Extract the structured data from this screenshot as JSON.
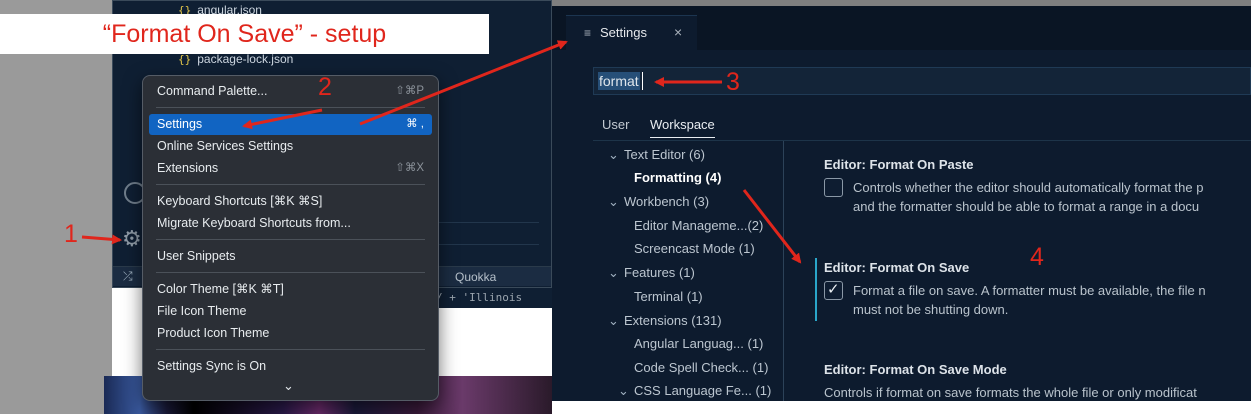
{
  "banner": {
    "title": "“Format On Save” - setup"
  },
  "editor": {
    "files": [
      {
        "icon": "{}",
        "name": "angular.json"
      },
      {
        "icon": "{}",
        "name": "package-lock.json"
      }
    ],
    "status_item": "Quokka",
    "code_snippet": "/  +  'Illinois"
  },
  "menu": {
    "items": [
      {
        "label": "Command Palette...",
        "shortcut": "⇧⌘P"
      },
      {
        "label": "Settings",
        "shortcut": "⌘ ,",
        "selected": true
      },
      {
        "label": "Online Services Settings",
        "shortcut": ""
      },
      {
        "label": "Extensions",
        "shortcut": "⇧⌘X"
      },
      {
        "label": "Keyboard Shortcuts [⌘K ⌘S]",
        "shortcut": ""
      },
      {
        "label": "Migrate Keyboard Shortcuts from...",
        "shortcut": ""
      },
      {
        "label": "User Snippets",
        "shortcut": ""
      },
      {
        "label": "Color Theme [⌘K ⌘T]",
        "shortcut": ""
      },
      {
        "label": "File Icon Theme",
        "shortcut": ""
      },
      {
        "label": "Product Icon Theme",
        "shortcut": ""
      },
      {
        "label": "Settings Sync is On",
        "shortcut": ""
      }
    ],
    "more_icon": "chevron-down-icon"
  },
  "settings": {
    "tab_label": "Settings",
    "tab_close": "×",
    "search_value": "format",
    "scopes": [
      "User",
      "Workspace"
    ],
    "active_scope": "Workspace",
    "toc": [
      {
        "label": "Text Editor",
        "count": "(6)",
        "expanded": true
      },
      {
        "label": "Formatting",
        "count": "(4)",
        "bold": true
      },
      {
        "label": "Workbench",
        "count": "(3)",
        "expanded": true
      },
      {
        "label": "Editor Manageme...",
        "count": "(2)"
      },
      {
        "label": "Screencast Mode",
        "count": "(1)"
      },
      {
        "label": "Features",
        "count": "(1)",
        "expanded": true
      },
      {
        "label": "Terminal",
        "count": "(1)"
      },
      {
        "label": "Extensions",
        "count": "(131)",
        "expanded": true
      },
      {
        "label": "Angular Languag...",
        "count": "(1)"
      },
      {
        "label": "Code Spell Check...",
        "count": "(1)"
      },
      {
        "label": "CSS Language Fe...",
        "count": "(1)",
        "expanded": true
      }
    ],
    "items": [
      {
        "category": "Editor: ",
        "name": "Format On Paste",
        "checked": false,
        "desc1": "Controls whether the editor should automatically format the p",
        "desc2": "and the formatter should be able to format a range in a docu"
      },
      {
        "category": "Editor: ",
        "name": "Format On Save",
        "checked": true,
        "desc1": "Format a file on save. A formatter must be available, the file n",
        "desc2": "must not be shutting down."
      },
      {
        "category": "Editor: ",
        "name": "Format On Save Mode",
        "desc1": "Controls if format on save formats the whole file or only modificat"
      }
    ]
  },
  "annotations": {
    "n1": "1",
    "n2": "2",
    "n3": "3",
    "n4": "4"
  },
  "colors": {
    "annotation": "#e0261c",
    "selection": "#1164c2",
    "focus": "#2aa6c9"
  }
}
